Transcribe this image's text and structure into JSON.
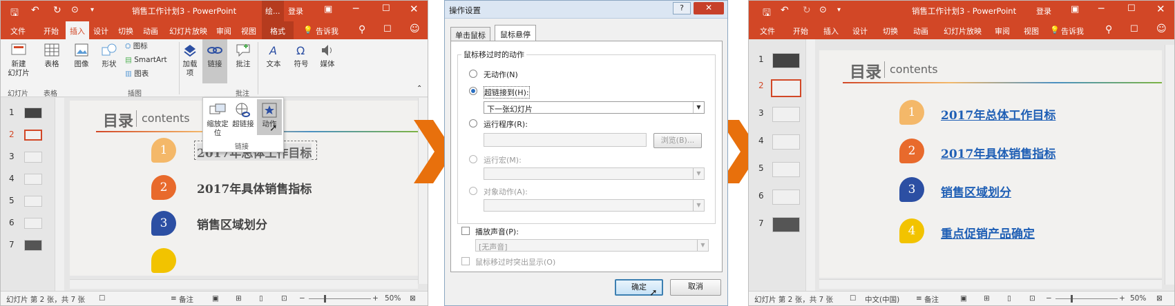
{
  "colors": {
    "accent": "#d24726",
    "arrow": "#e8700c",
    "link": "#1f5fb5"
  },
  "left": {
    "title": "销售工作计划3 - PowerPoint",
    "draw_tab": "绘...",
    "login": "登录",
    "menu": [
      "文件",
      "开始",
      "插入",
      "设计",
      "切换",
      "动画",
      "幻灯片放映",
      "审阅",
      "视图",
      "格式",
      "告诉我"
    ],
    "ribbon": {
      "new_slide": "新建\n幻灯片",
      "table": "表格",
      "image": "图像",
      "shape": "形状",
      "icon": "图标",
      "smartart": "SmartArt",
      "chart": "图表",
      "addin": "加载\n项",
      "link": "链接",
      "comment": "批注",
      "text": "文本",
      "symbol": "符号",
      "media": "媒体",
      "groups": [
        "幻灯片",
        "表格",
        "插图",
        "批注"
      ]
    },
    "link_popup": {
      "zoom": "缩放定\n位",
      "hyperlink": "超链接",
      "action": "动作",
      "group": "链接"
    },
    "slide_numbers": [
      "1",
      "2",
      "3",
      "4",
      "5",
      "6",
      "7"
    ],
    "status": {
      "slide": "幻灯片 第 2 张，共 7 张",
      "notes": "备注",
      "zoom": "50%"
    }
  },
  "slide": {
    "heading": "目录",
    "heading_en": "contents",
    "items": [
      {
        "num": "1",
        "text": "2017年总体工作目标",
        "color": "#f4b869"
      },
      {
        "num": "2",
        "text": "2017年具体销售指标",
        "color": "#e86a2c"
      },
      {
        "num": "3",
        "text": "销售区域划分",
        "color": "#2c4fa3"
      },
      {
        "num": "4",
        "text": "重点促销产品确定",
        "color": "#f2c300"
      }
    ]
  },
  "dialog": {
    "title": "操作设置",
    "help": "?",
    "tabs": [
      "单击鼠标",
      "鼠标悬停"
    ],
    "group_label": "鼠标移过时的动作",
    "none": "无动作(N)",
    "hyperlink": "超链接到(H):",
    "hyperlink_value": "下一张幻灯片",
    "run_program": "运行程序(R):",
    "browse": "浏览(B)...",
    "run_macro": "运行宏(M):",
    "object_action": "对象动作(A):",
    "play_sound": "播放声音(P):",
    "sound_value": "[无声音]",
    "highlight": "鼠标移过时突出显示(O)",
    "ok": "确定",
    "cancel": "取消"
  },
  "right": {
    "title": "销售工作计划3 - PowerPoint",
    "login": "登录",
    "menu": [
      "文件",
      "开始",
      "插入",
      "设计",
      "切换",
      "动画",
      "幻灯片放映",
      "审阅",
      "视图",
      "告诉我"
    ],
    "slide_numbers": [
      "1",
      "2",
      "3",
      "4",
      "5",
      "6",
      "7"
    ],
    "status": {
      "slide": "幻灯片 第 2 张，共 7 张",
      "lang": "中文(中国)",
      "notes": "备注",
      "zoom": "50%"
    }
  }
}
